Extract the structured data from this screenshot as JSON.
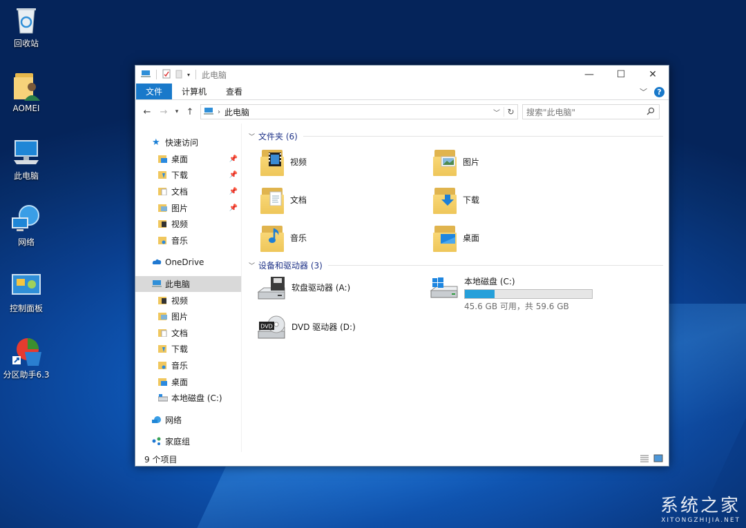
{
  "desktop": {
    "icons": [
      {
        "label": "回收站",
        "icon": "recycle-bin-icon"
      },
      {
        "label": "AOMEI",
        "icon": "user-folder-icon"
      },
      {
        "label": "此电脑",
        "icon": "computer-icon"
      },
      {
        "label": "网络",
        "icon": "network-globe-icon"
      },
      {
        "label": "控制面板",
        "icon": "control-panel-icon"
      },
      {
        "label": "分区助手6.3",
        "icon": "partition-assistant-icon"
      }
    ]
  },
  "window": {
    "title": "此电脑",
    "ribbon_tabs": [
      "文件",
      "计算机",
      "查看"
    ],
    "address": {
      "crumb": "此电脑"
    },
    "search": {
      "placeholder": "搜索\"此电脑\""
    },
    "nav": {
      "quick_access": "快速访问",
      "quick_items": [
        "桌面",
        "下载",
        "文档",
        "图片",
        "视频",
        "音乐"
      ],
      "onedrive": "OneDrive",
      "this_pc": "此电脑",
      "pc_items": [
        "视频",
        "图片",
        "文档",
        "下载",
        "音乐",
        "桌面",
        "本地磁盘 (C:)"
      ],
      "network": "网络",
      "homegroup": "家庭组"
    },
    "folders_group": "文件夹 (6)",
    "folders": [
      "视频",
      "图片",
      "文档",
      "下载",
      "音乐",
      "桌面"
    ],
    "devices_group": "设备和驱动器 (3)",
    "drives": {
      "floppy": "软盘驱动器 (A:)",
      "local": "本地磁盘 (C:)",
      "local_space": "45.6 GB 可用，共 59.6 GB",
      "local_used_fraction": 0.235,
      "dvd": "DVD 驱动器 (D:)",
      "dvd_badge": "DVD"
    },
    "status": "9 个项目"
  },
  "watermark": {
    "title": "系统之家",
    "url": "XITONGZHIJIA.NET"
  },
  "colors": {
    "accent": "#1979ca",
    "folder": "#f0c75e",
    "progress": "#26a0da"
  }
}
